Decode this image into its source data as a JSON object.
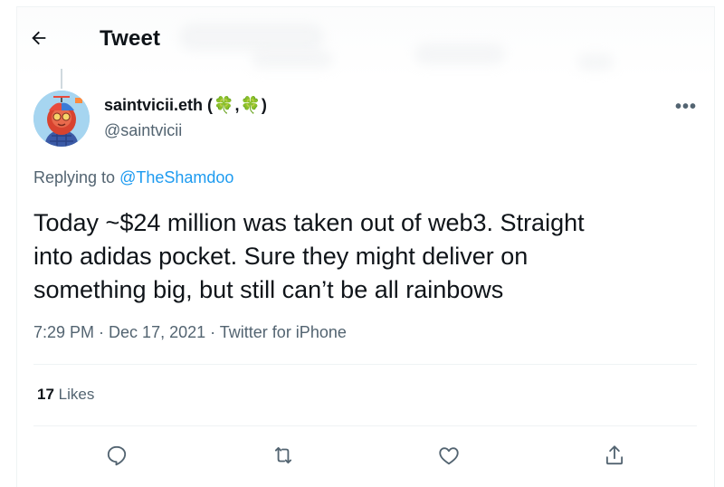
{
  "header": {
    "title": "Tweet"
  },
  "tweet": {
    "display_name": "saintvicii.eth",
    "name_open": "(",
    "clover_1": "🍀",
    "name_sep": ", ",
    "clover_2": "🍀",
    "name_close": ")",
    "handle": "@saintvicii",
    "replying_prefix": "Replying to ",
    "replying_to": "@TheShamdoo",
    "text_line_1": "Today ~$24 million was taken out of web3. Straight",
    "text_line_2": "into adidas pocket. Sure they might deliver on",
    "text_line_3": "something big, but still can’t be all rainbows",
    "time": "7:29 PM",
    "dot_1": " · ",
    "date": "Dec 17, 2021",
    "dot_2": " · ",
    "source": "Twitter for iPhone",
    "likes_count": "17",
    "likes_label": " Likes"
  },
  "more_menu": "•••",
  "icons": {
    "back": "back-arrow-icon",
    "reply": "reply-icon",
    "retweet": "retweet-icon",
    "like": "heart-icon",
    "share": "share-icon"
  },
  "colors": {
    "link": "#1d9bf0",
    "secondary_text": "#536471",
    "clover": "#3a9b3a"
  }
}
